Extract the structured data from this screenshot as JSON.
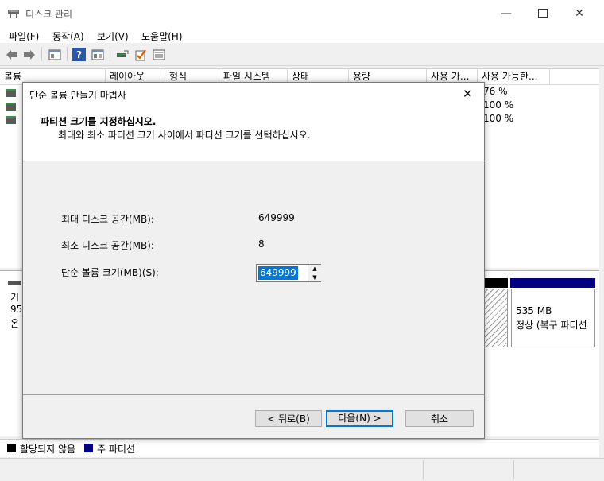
{
  "app": {
    "title": "디스크 관리"
  },
  "menu": [
    "파일(F)",
    "동작(A)",
    "보기(V)",
    "도움말(H)"
  ],
  "list": {
    "columns": [
      "볼륨",
      "레이아웃",
      "형식",
      "파일 시스템",
      "상태",
      "용량",
      "사용 가...",
      "사용 가능한..."
    ],
    "rows": [
      {
        "pct": "76 %"
      },
      {
        "pct": "100 %"
      },
      {
        "pct": "100 %"
      }
    ]
  },
  "graph": {
    "disk_label_partial": [
      "기",
      "95",
      "온"
    ],
    "recovery": {
      "size": "535 MB",
      "status": "정상 (복구 파티션"
    }
  },
  "legend": {
    "unallocated": "할당되지 않음",
    "primary": "주 파티션"
  },
  "colors": {
    "unallocated": "#000000",
    "primary": "#000080",
    "accent": "#0078d7"
  },
  "wizard": {
    "title": "단순 볼륨 만들기 마법사",
    "heading": "파티션 크기를 지정하십시오.",
    "subheading": "최대와 최소 파티션 크기 사이에서 파티션 크기를 선택하십시오.",
    "max_label": "최대 디스크 공간(MB):",
    "max_value": "649999",
    "min_label": "최소 디스크 공간(MB):",
    "min_value": "8",
    "size_label": "단순 볼륨 크기(MB)(S):",
    "size_value": "649999",
    "back_label": "< 뒤로(B)",
    "next_label": "다음(N) >",
    "cancel_label": "취소"
  }
}
